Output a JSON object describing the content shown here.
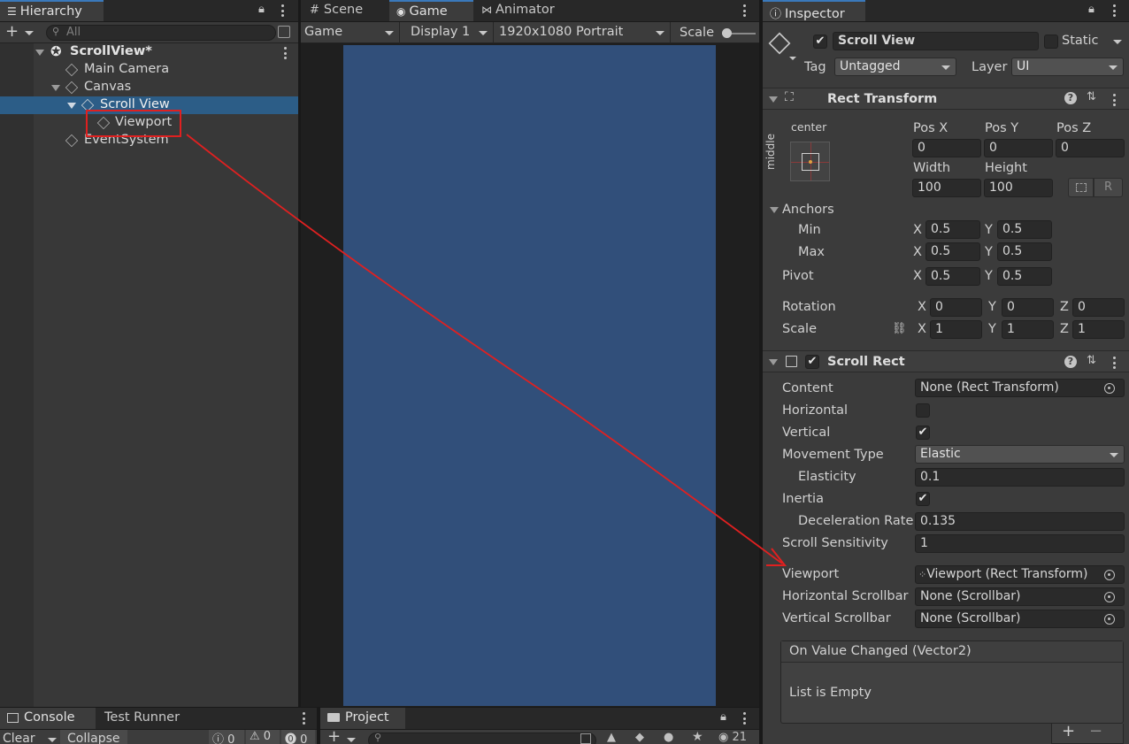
{
  "hierarchy": {
    "tab_label": "Hierarchy",
    "search_placeholder": "All",
    "scene_name": "ScrollView*",
    "items": [
      {
        "label": "Main Camera"
      },
      {
        "label": "Canvas"
      },
      {
        "label": "Scroll View"
      },
      {
        "label": "Viewport"
      },
      {
        "label": "EventSystem"
      }
    ]
  },
  "game_view": {
    "tabs": [
      "Scene",
      "Game",
      "Animator"
    ],
    "view_dropdown": "Game",
    "display_dropdown": "Display 1",
    "resolution_dropdown": "1920x1080 Portrait",
    "scale_label": "Scale",
    "canvas_color": "#314f7a"
  },
  "inspector": {
    "tab_label": "Inspector",
    "object_name": "Scroll View",
    "static_label": "Static",
    "tag_label": "Tag",
    "tag_value": "Untagged",
    "layer_label": "Layer",
    "layer_value": "UI",
    "rect_transform": {
      "title": "Rect Transform",
      "anchor_h": "center",
      "anchor_v": "middle",
      "pos_x_label": "Pos X",
      "pos_y_label": "Pos Y",
      "pos_z_label": "Pos Z",
      "pos_x": "0",
      "pos_y": "0",
      "pos_z": "0",
      "width_label": "Width",
      "height_label": "Height",
      "width": "100",
      "height": "100",
      "r_button": "R",
      "anchors_label": "Anchors",
      "min_label": "Min",
      "max_label": "Max",
      "pivot_label": "Pivot",
      "min_x": "0.5",
      "min_y": "0.5",
      "max_x": "0.5",
      "max_y": "0.5",
      "pivot_x": "0.5",
      "pivot_y": "0.5",
      "rotation_label": "Rotation",
      "scale_label": "Scale",
      "rot_x": "0",
      "rot_y": "0",
      "rot_z": "0",
      "scale_x": "1",
      "scale_y": "1",
      "scale_z": "1",
      "x": "X",
      "y": "Y",
      "z": "Z"
    },
    "scroll_rect": {
      "title": "Scroll Rect",
      "content_label": "Content",
      "content_value": "None (Rect Transform)",
      "horizontal_label": "Horizontal",
      "vertical_label": "Vertical",
      "movement_type_label": "Movement Type",
      "movement_type_value": "Elastic",
      "elasticity_label": "Elasticity",
      "elasticity_value": "0.1",
      "inertia_label": "Inertia",
      "deceleration_label": "Deceleration Rate",
      "deceleration_value": "0.135",
      "sensitivity_label": "Scroll Sensitivity",
      "sensitivity_value": "1",
      "viewport_label": "Viewport",
      "viewport_value": "Viewport (Rect Transform)",
      "hscrollbar_label": "Horizontal Scrollbar",
      "hscrollbar_value": "None (Scrollbar)",
      "vscrollbar_label": "Vertical Scrollbar",
      "vscrollbar_value": "None (Scrollbar)",
      "event_title": "On Value Changed (Vector2)",
      "event_empty": "List is Empty",
      "add": "+",
      "remove": "−"
    }
  },
  "bottom": {
    "console_tab": "Console",
    "test_runner_tab": "Test Runner",
    "clear_button": "Clear",
    "collapse_button": "Collapse",
    "log_count": "0",
    "warn_count": "0",
    "error_count": "0",
    "project_tab": "Project",
    "hidden_count": "21"
  },
  "annotation": {
    "arrow_color": "#e02020"
  }
}
